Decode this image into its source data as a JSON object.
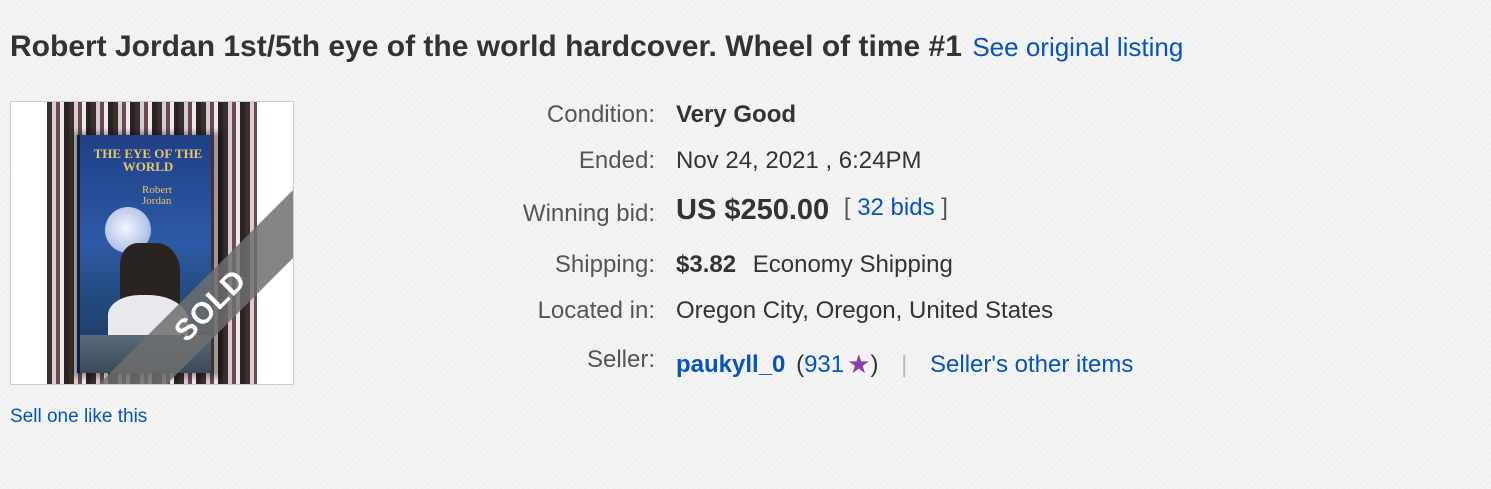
{
  "listing": {
    "title": "Robert Jordan 1st/5th eye of the world hardcover. Wheel of time #1",
    "see_original_label": "See original listing",
    "sell_one_label": "Sell one like this",
    "image": {
      "badge_text": "SOLD",
      "cover_title": "THE EYE OF THE WORLD",
      "cover_author": "Robert Jordan"
    }
  },
  "details": {
    "condition": {
      "label": "Condition:",
      "value": "Very Good"
    },
    "ended": {
      "label": "Ended:",
      "value": "Nov 24, 2021 , 6:24PM"
    },
    "winning_bid": {
      "label": "Winning bid:",
      "amount": "US $250.00",
      "bracket_open": "[",
      "bids_label": "32 bids",
      "bracket_close": "]"
    },
    "shipping": {
      "label": "Shipping:",
      "cost": "$3.82",
      "method": "Economy Shipping"
    },
    "location": {
      "label": "Located in:",
      "value": "Oregon City, Oregon, United States"
    },
    "seller": {
      "label": "Seller:",
      "name": "paukyll_0",
      "paren_open": "(",
      "feedback_score": "931",
      "paren_close": ")",
      "star_icon": "purple-star-icon",
      "separator": "|",
      "other_items_label": "Seller's other items"
    }
  },
  "colors": {
    "link": "#0654ba",
    "text": "#333333",
    "label": "#555555",
    "star": "#8e3fa6",
    "background": "#f2f2f2"
  }
}
